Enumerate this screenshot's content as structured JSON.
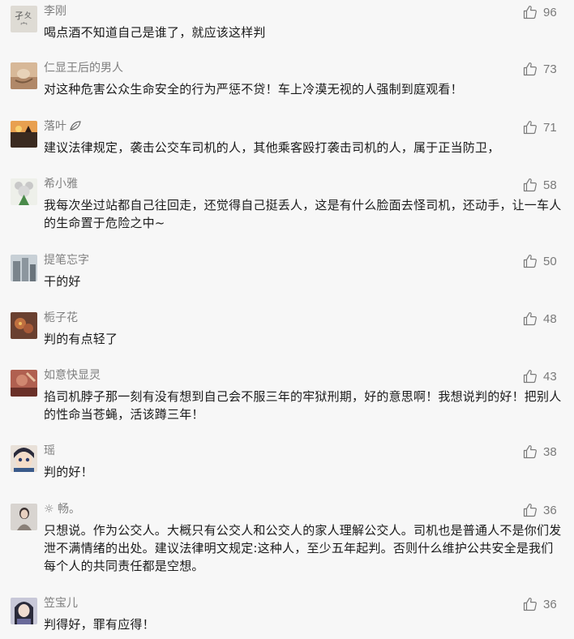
{
  "comments": [
    {
      "nickname": "李刚",
      "content": "喝点酒不知道自己是谁了，就应该这样判",
      "likes": "96",
      "avatar": "calligraphy-avatar",
      "avatar_color": "#d9d6cf"
    },
    {
      "nickname": "仁显王后的男人",
      "content": "对这种危害公众生命安全的行为严惩不贷！车上冷漠无视的人强制到庭观看！",
      "likes": "73",
      "avatar": "photo-avatar",
      "avatar_color": "#c9a98a"
    },
    {
      "nickname": "落叶",
      "nickname_icon": "leaf-icon",
      "content": "建议法律规定，袭击公交车司机的人，其他乘客殴打袭击司机的人，属于正当防卫，",
      "likes": "71",
      "avatar": "sunset-avatar",
      "avatar_color": "#5b4a3a"
    },
    {
      "nickname": "希小雅",
      "content": "我每次坐过站都自己往回走，还觉得自己挺丢人，这是有什么脸面去怪司机，还动手，让一车人的生命置于危险之中~",
      "likes": "58",
      "avatar": "cartoon-avatar",
      "avatar_color": "#e8ece6"
    },
    {
      "nickname": "提笔忘字",
      "content": "干的好",
      "likes": "50",
      "avatar": "building-avatar",
      "avatar_color": "#9aa3aa"
    },
    {
      "nickname": "栀子花",
      "content": "判的有点轻了",
      "likes": "48",
      "avatar": "flower-avatar",
      "avatar_color": "#6a4030"
    },
    {
      "nickname": "如意快显灵",
      "content": "掐司机脖子那一刻有没有想到自己会不服三年的牢狱刑期，好的意思啊！我想说判的好！把别人的性命当苍蝇，活该蹲三年！",
      "likes": "43",
      "avatar": "red-avatar",
      "avatar_color": "#8a4a40"
    },
    {
      "nickname": "瑶",
      "content": "判的好！",
      "likes": "38",
      "avatar": "cartoon-face-avatar",
      "avatar_color": "#3a5a8a"
    },
    {
      "nickname": "畅。",
      "nickname_prefix": "☼",
      "content": "只想说。作为公交人。大概只有公交人和公交人的家人理解公交人。司机也是普通人不是你们发泄不满情绪的出处。建议法律明文规定:这种人，至少五年起判。否则什么维护公共安全是我们每个人的共同责任都是空想。",
      "likes": "36",
      "avatar": "portrait-avatar",
      "avatar_color": "#b0a8a0"
    },
    {
      "nickname": "笠宝儿",
      "content": "判得好，罪有应得！",
      "likes": "36",
      "avatar": "anime-avatar",
      "avatar_color": "#4a4a6a"
    }
  ]
}
